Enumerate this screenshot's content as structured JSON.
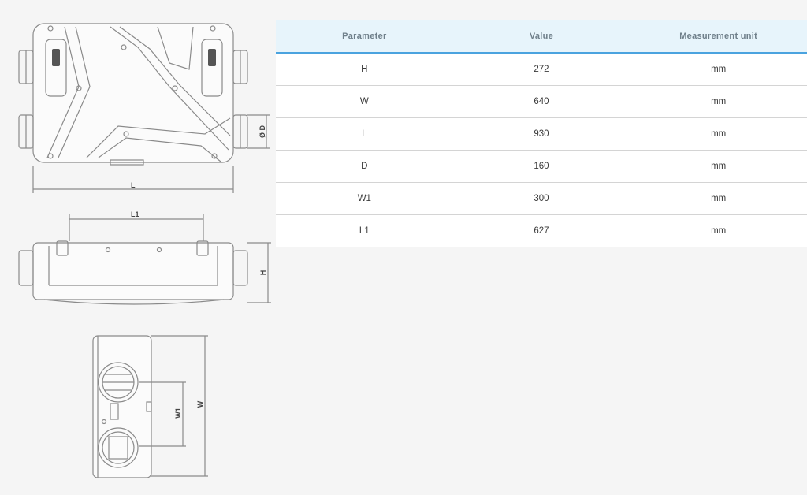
{
  "drawings": {
    "labels": {
      "L": "L",
      "L1": "L1",
      "H": "H",
      "D": "Ø D",
      "W": "W",
      "W1": "W1"
    }
  },
  "table": {
    "headers": [
      "Parameter",
      "Value",
      "Measurement unit"
    ],
    "rows": [
      [
        "H",
        "272",
        "mm"
      ],
      [
        "W",
        "640",
        "mm"
      ],
      [
        "L",
        "930",
        "mm"
      ],
      [
        "D",
        "160",
        "mm"
      ],
      [
        "W1",
        "300",
        "mm"
      ],
      [
        "L1",
        "627",
        "mm"
      ]
    ]
  }
}
